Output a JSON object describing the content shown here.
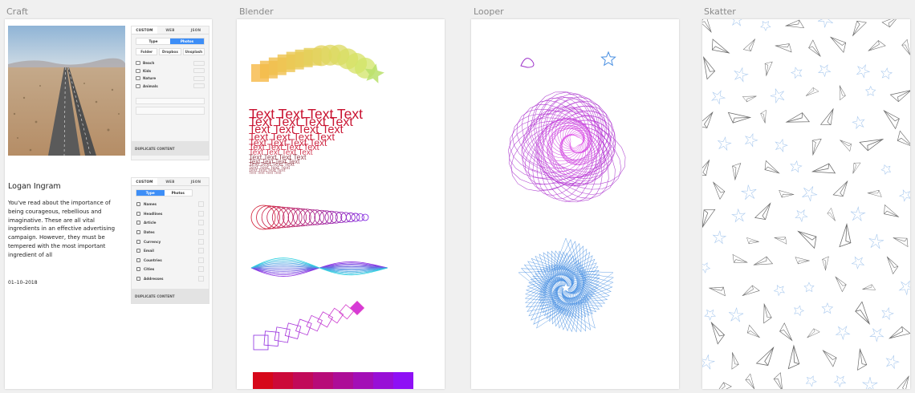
{
  "artboards": {
    "craft": "Craft",
    "blender": "Blender",
    "looper": "Looper",
    "skatter": "Skatter"
  },
  "craft_panel_top": {
    "tabs": [
      "CUSTOM",
      "WEB",
      "JSON"
    ],
    "segment": [
      "Type",
      "Photos"
    ],
    "buttons": [
      "Folder",
      "Dropbox",
      "Unsplash"
    ],
    "categories": [
      "Beach",
      "Kids",
      "Nature",
      "Animals"
    ],
    "duplicate_label": "DUPLICATE CONTENT"
  },
  "craft_panel_bottom": {
    "tabs": [
      "CUSTOM",
      "WEB",
      "JSON"
    ],
    "segment": [
      "Type",
      "Photos"
    ],
    "items": [
      "Names",
      "Headlines",
      "Article",
      "Dates",
      "Currency",
      "Email",
      "Countries",
      "Cities",
      "Addresses"
    ],
    "duplicate_label": "DUPLICATE CONTENT"
  },
  "article": {
    "author": "Logan Ingram",
    "body": "You've read about the importance of being courageous, rebellious and imaginative. These are all vital ingredients in an effective advertising campaign. However, they must be tempered with the most important ingredient of all",
    "date": "01–10–2018"
  },
  "blender_text": "Text Text Text Text",
  "colors": {
    "accent_blue": "#3d8ef7",
    "text_red": "#c8102e",
    "loop_purple": "#b13be8",
    "loop_blue": "#4a90e2"
  }
}
